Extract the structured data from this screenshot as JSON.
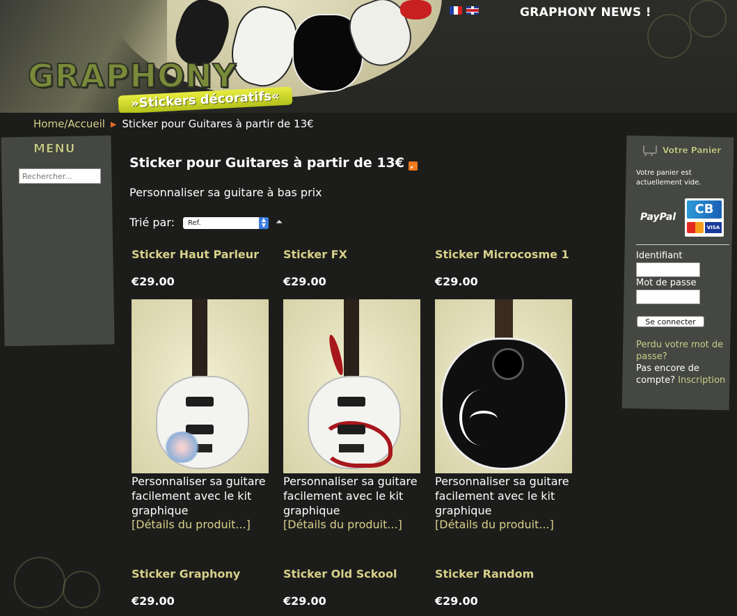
{
  "header": {
    "logo_text": "GRAPHONY",
    "tagline": "»Stickers décoratifs«",
    "news": "GRAPHONY NEWS !"
  },
  "breadcrumb": {
    "home": "Home/Accueil",
    "current": "Sticker pour Guitares à partir de 13€"
  },
  "menu": {
    "title": "MENU",
    "search_placeholder": "Rechercher..."
  },
  "main": {
    "title": "Sticker pour Guitares à partir de 13€",
    "subtitle": "Personnaliser sa guitare à bas prix",
    "sort_label": "Trié par:",
    "sort_value": "Ref."
  },
  "products": [
    {
      "name": "Sticker Haut Parleur",
      "price": "€29.00",
      "desc": "Personnaliser sa guitare facilement avec le kit graphique",
      "link": "[Détails du produit...]"
    },
    {
      "name": "Sticker FX",
      "price": "€29.00",
      "desc": "Personnaliser sa guitare facilement avec le kit graphique",
      "link": "[Détails du produit...]"
    },
    {
      "name": "Sticker Microcosme 1",
      "price": "€29.00",
      "desc": "Personnaliser sa guitare facilement avec le kit graphique",
      "link": "[Détails du produit...]"
    },
    {
      "name": "Sticker Graphony",
      "price": "€29.00"
    },
    {
      "name": "Sticker Old Sckool",
      "price": "€29.00"
    },
    {
      "name": "Sticker Random",
      "price": "€29.00"
    }
  ],
  "cart": {
    "title": "Votre Panier",
    "empty_text": "Votre panier est actuellement vide.",
    "paypal": "PayPal",
    "cb": "CB",
    "visa": "VISA",
    "identifiant_label": "Identifiant",
    "password_label": "Mot de passe",
    "login_button": "Se connecter",
    "forgot": "Perdu votre mot de passe?",
    "no_account": "Pas encore de compte?",
    "signup": "Inscription"
  },
  "colors": {
    "background": "#1c1d1b",
    "panel": "#454742",
    "accent_text": "#d8d08a",
    "sort_button": "#3a7de0"
  }
}
